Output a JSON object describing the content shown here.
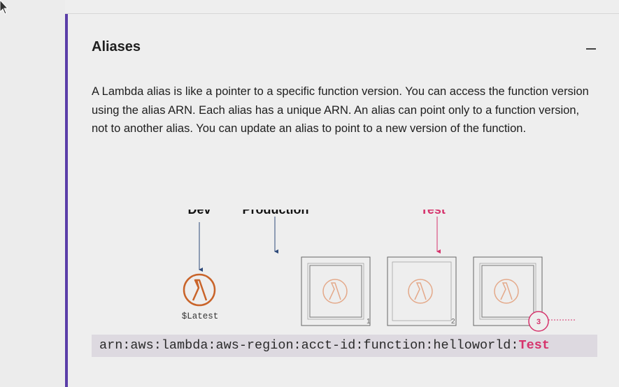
{
  "section": {
    "title": "Aliases",
    "collapse_icon": "minus-icon",
    "description": "A Lambda alias is like a pointer to a specific function version. You can access the function version using the alias ARN. Each alias has a unique ARN. An alias can point only to a function version, not to another alias. You can update an alias to point to a new version of the function."
  },
  "diagram": {
    "aliases": [
      "Dev",
      "Production",
      "Test"
    ],
    "latest_label": "$Latest",
    "version_numbers": [
      "1",
      "2"
    ],
    "highlight_version": "3",
    "arn_prefix": "arn:aws:lambda:aws-region:acct-id:function:helloworld:",
    "arn_alias": "Test"
  },
  "colors": {
    "accent": "#5b3ea8",
    "test_pink": "#d6336c",
    "lambda_orange": "#c9642a",
    "arrow_blue": "#2e4a7a"
  }
}
